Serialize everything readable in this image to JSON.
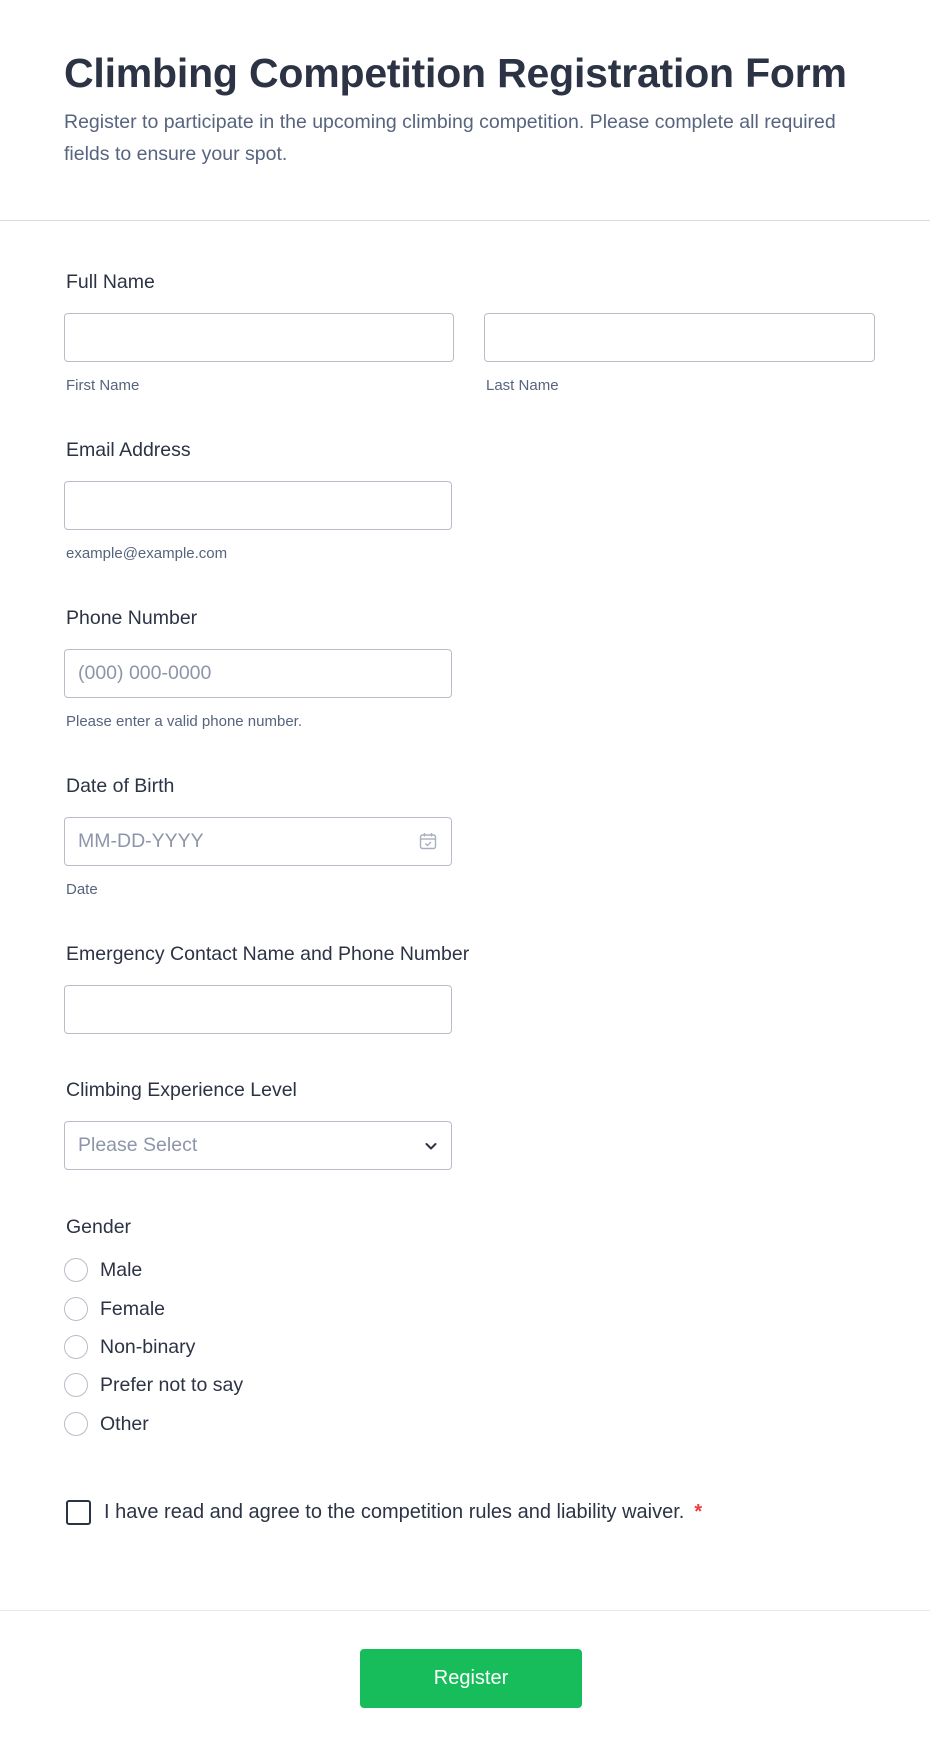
{
  "form": {
    "title": "Climbing Competition Registration Form",
    "subtitle": "Register to participate in the upcoming climbing competition. Please complete all required fields to ensure your spot."
  },
  "full_name": {
    "label": "Full Name",
    "first_label": "First Name",
    "last_label": "Last Name",
    "first_value": "",
    "last_value": ""
  },
  "email": {
    "label": "Email Address",
    "sublabel": "example@example.com",
    "value": ""
  },
  "phone": {
    "label": "Phone Number",
    "placeholder": "(000) 000-0000",
    "sublabel": "Please enter a valid phone number."
  },
  "dob": {
    "label": "Date of Birth",
    "placeholder": "MM-DD-YYYY",
    "sublabel": "Date",
    "icon": "calendar-icon"
  },
  "emergency": {
    "label": "Emergency Contact Name and Phone Number",
    "value": ""
  },
  "experience": {
    "label": "Climbing Experience Level",
    "selected": "Please Select",
    "icon": "chevron-down-icon"
  },
  "gender": {
    "label": "Gender",
    "options": [
      "Male",
      "Female",
      "Non-binary",
      "Prefer not to say",
      "Other"
    ]
  },
  "agreement": {
    "label": "I have read and agree to the competition rules and liability waiver.",
    "required_mark": "*"
  },
  "submit": {
    "label": "Register"
  },
  "colors": {
    "accent": "#18bd5b",
    "text": "#2c3345",
    "muted": "#57647e",
    "border": "#b8bdc9",
    "required": "#f23a3c"
  }
}
